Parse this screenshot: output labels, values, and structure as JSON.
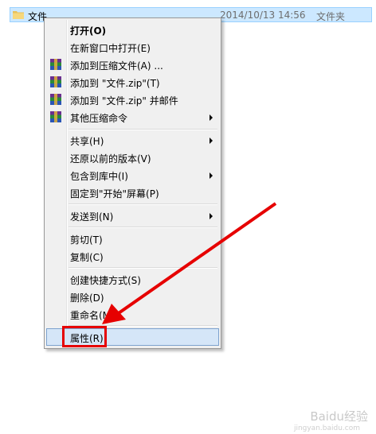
{
  "file": {
    "name": "文件",
    "date": "2014/10/13 14:56",
    "type": "文件夹",
    "icon": "folder-icon"
  },
  "menu": {
    "items": [
      {
        "label": "打开(O)",
        "bold": true
      },
      {
        "label": "在新窗口中打开(E)"
      },
      {
        "label": "添加到压缩文件(A) ...",
        "icon": "winrar-icon"
      },
      {
        "label": "添加到 \"文件.zip\"(T)",
        "icon": "winrar-icon"
      },
      {
        "label": "添加到 \"文件.zip\" 并邮件",
        "icon": "winrar-icon"
      },
      {
        "label": "其他压缩命令",
        "icon": "winrar-icon",
        "submenu": true
      },
      {
        "label": "共享(H)",
        "submenu": true
      },
      {
        "label": "还原以前的版本(V)"
      },
      {
        "label": "包含到库中(I)",
        "submenu": true
      },
      {
        "label": "固定到\"开始\"屏幕(P)"
      },
      {
        "label": "发送到(N)",
        "submenu": true
      },
      {
        "label": "剪切(T)"
      },
      {
        "label": "复制(C)"
      },
      {
        "label": "创建快捷方式(S)"
      },
      {
        "label": "删除(D)"
      },
      {
        "label": "重命名(M)"
      },
      {
        "label": "属性(R)",
        "highlighted": true
      }
    ]
  },
  "annotation": {
    "color": "#e60000"
  },
  "watermark": {
    "text": "Baidu经验",
    "sub": "jingyan.baidu.com"
  }
}
